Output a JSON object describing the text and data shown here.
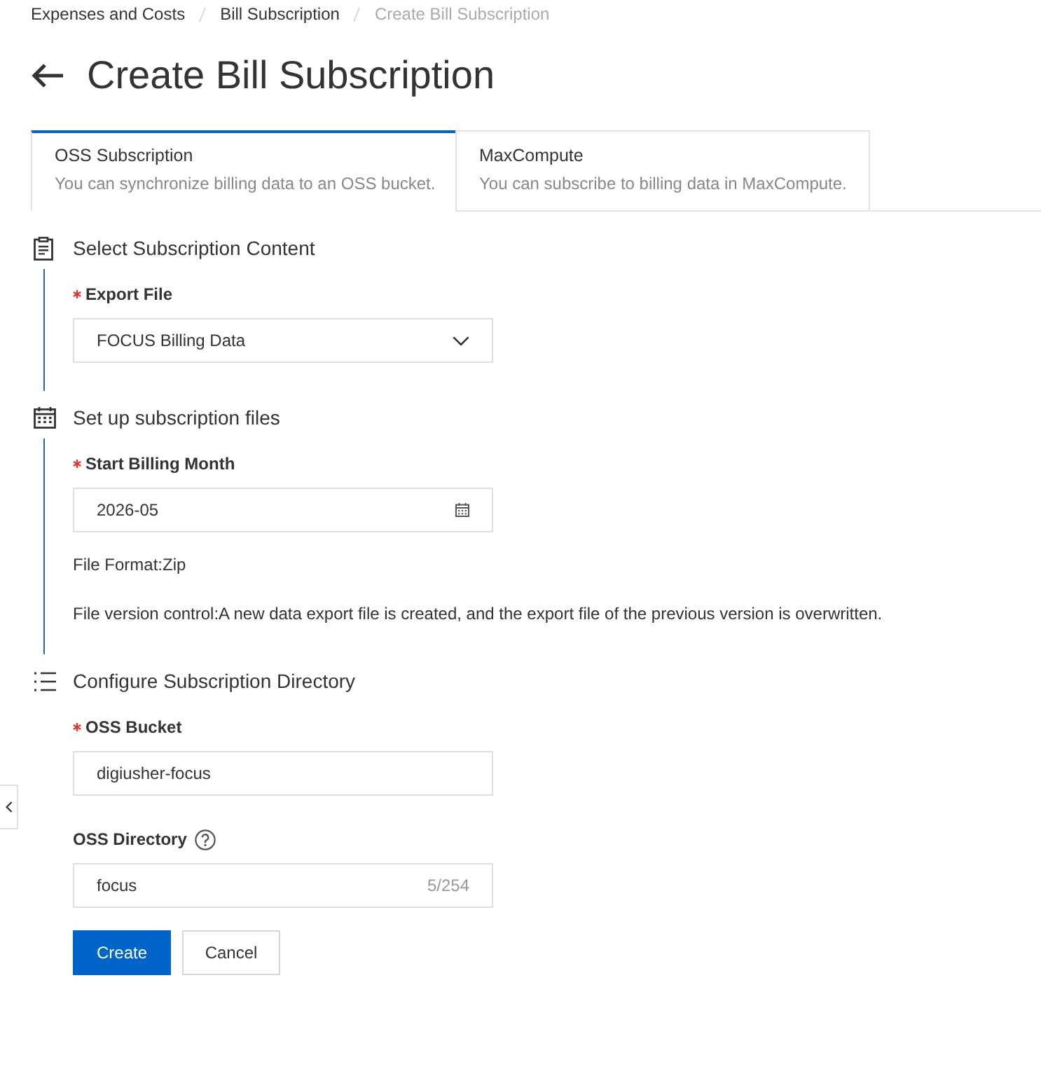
{
  "breadcrumb": [
    {
      "label": "Expenses and Costs",
      "current": false
    },
    {
      "label": "Bill Subscription",
      "current": false
    },
    {
      "label": "Create Bill Subscription",
      "current": true
    }
  ],
  "page_title": "Create Bill Subscription",
  "tabs": [
    {
      "title": "OSS Subscription",
      "description": "You can synchronize billing data to an OSS bucket.",
      "selected": true
    },
    {
      "title": "MaxCompute",
      "description": "You can subscribe to billing data in MaxCompute.",
      "selected": false
    }
  ],
  "steps": [
    {
      "title": "Select Subscription Content",
      "fields": [
        {
          "kind": "select",
          "label": "Export File",
          "required": true,
          "help": false,
          "value": "FOCUS Billing Data"
        }
      ]
    },
    {
      "title": "Set up subscription files",
      "fields": [
        {
          "kind": "month",
          "label": "Start Billing Month",
          "required": true,
          "help": false,
          "value": "2026-05"
        }
      ],
      "notes": [
        "File Format:Zip",
        "File version control:A new data export file is created, and the export file of the previous version is overwritten."
      ]
    },
    {
      "title": "Configure Subscription Directory",
      "fields": [
        {
          "kind": "text",
          "label": "OSS Bucket",
          "required": true,
          "help": false,
          "value": "digiusher-focus"
        },
        {
          "kind": "text",
          "label": "OSS Directory",
          "required": false,
          "help": true,
          "value": "focus",
          "counter": "5/254"
        }
      ]
    }
  ],
  "buttons": [
    {
      "label": "Create",
      "kind": "primary"
    },
    {
      "label": "Cancel",
      "kind": "secondary"
    }
  ]
}
